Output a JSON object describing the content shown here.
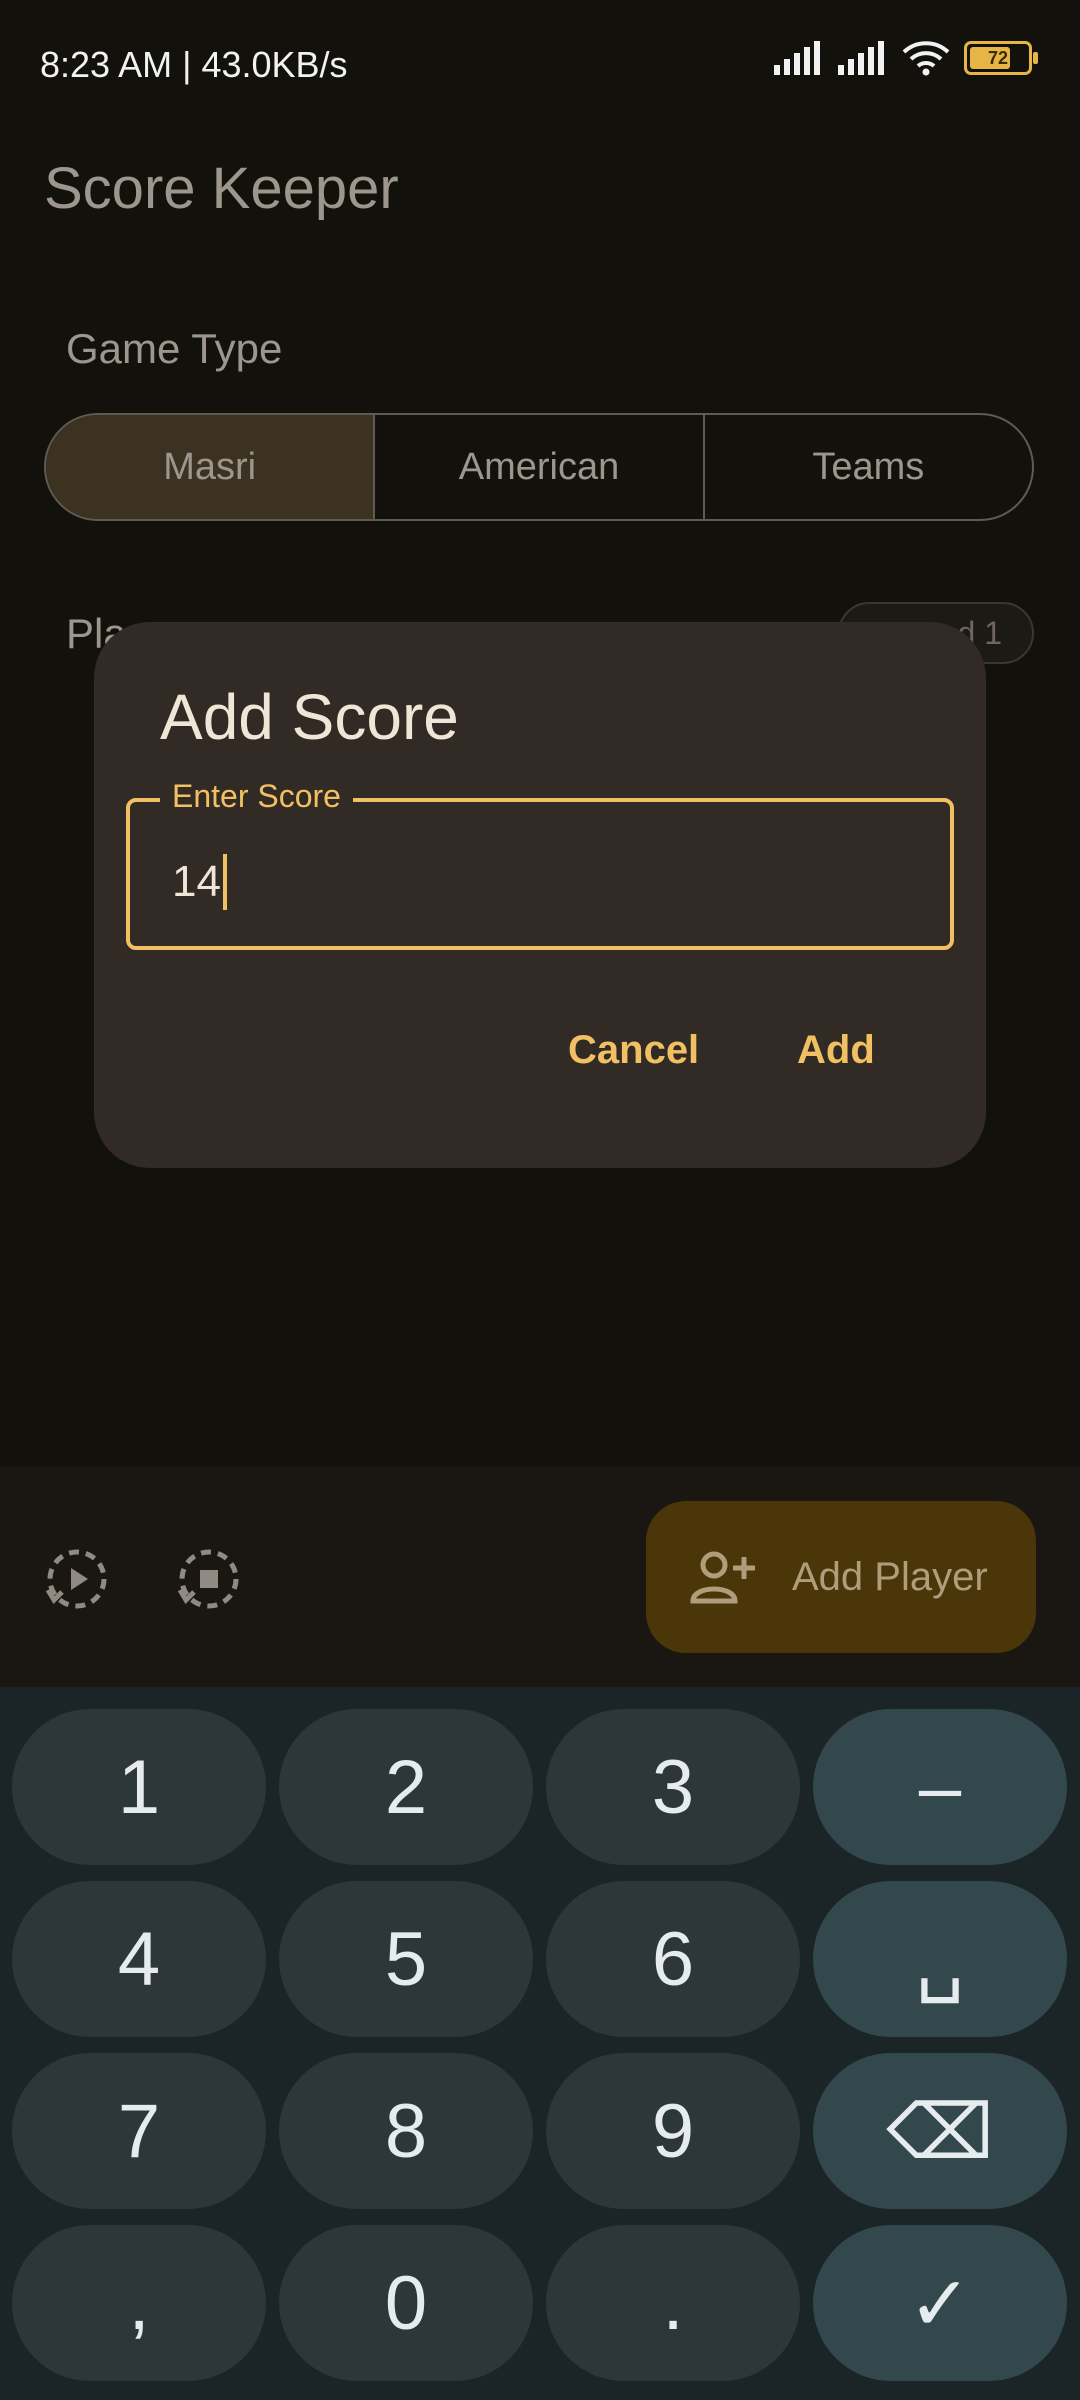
{
  "status_bar": {
    "time_speed": "8:23 AM | 43.0KB/s",
    "battery_level": "72",
    "battery_fraction": 0.72,
    "accent": "#e6b545"
  },
  "app": {
    "title": "Score Keeper"
  },
  "game_type": {
    "label": "Game Type",
    "options": [
      "Masri",
      "American",
      "Teams"
    ],
    "selected": "Masri"
  },
  "players": {
    "label": "Pla",
    "round_badge": "d 1"
  },
  "dialog": {
    "title": "Add Score",
    "field_label": "Enter Score",
    "field_value": "14",
    "cancel_label": "Cancel",
    "add_label": "Add"
  },
  "bottom_bar": {
    "icons": [
      "replay-round-icon",
      "stop-round-icon"
    ],
    "add_player_label": "Add Player",
    "add_player_icon": "person-add-icon"
  },
  "keyboard": {
    "rows": [
      [
        "1",
        "2",
        "3",
        "–"
      ],
      [
        "4",
        "5",
        "6",
        "␣"
      ],
      [
        "7",
        "8",
        "9",
        "⌫"
      ],
      [
        ",",
        "0",
        ".",
        "✓"
      ]
    ]
  },
  "colors": {
    "background": "#13110c",
    "dialog": "#322a24",
    "accent": "#f0c063",
    "fab": "#4a3608",
    "keyboard": "#1b2426"
  }
}
